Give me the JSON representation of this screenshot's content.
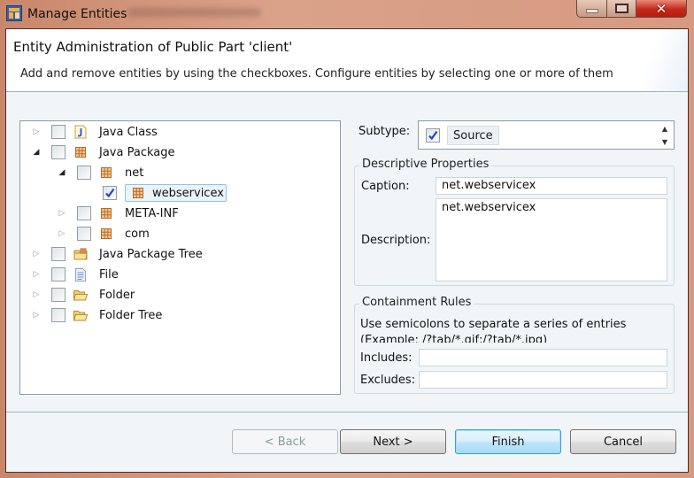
{
  "window": {
    "title": "Manage Entities",
    "controls": {
      "minimize": "minimize",
      "maximize": "maximize",
      "close": "close"
    }
  },
  "header": {
    "title": "Entity Administration of Public Part 'client'",
    "description": "Add and remove entities by using the checkboxes. Configure entities by selecting one or more of them"
  },
  "tree": {
    "items": [
      {
        "label": "Java Class",
        "icon": "java-class-icon",
        "expanded": false,
        "checked": false,
        "level": 0,
        "selected": false
      },
      {
        "label": "Java Package",
        "icon": "java-package-icon",
        "expanded": true,
        "checked": false,
        "level": 0,
        "selected": false
      },
      {
        "label": "net",
        "icon": "java-package-icon",
        "expanded": true,
        "checked": false,
        "level": 1,
        "selected": false
      },
      {
        "label": "webservicex",
        "icon": "java-package-icon",
        "expanded": null,
        "checked": true,
        "level": 2,
        "selected": true
      },
      {
        "label": "META-INF",
        "icon": "java-package-icon",
        "expanded": false,
        "checked": false,
        "level": 1,
        "selected": false
      },
      {
        "label": "com",
        "icon": "java-package-icon",
        "expanded": false,
        "checked": false,
        "level": 1,
        "selected": false
      },
      {
        "label": "Java Package Tree",
        "icon": "package-folder-icon",
        "expanded": false,
        "checked": false,
        "level": 0,
        "selected": false
      },
      {
        "label": "File",
        "icon": "file-icon",
        "expanded": false,
        "checked": false,
        "level": 0,
        "selected": false
      },
      {
        "label": "Folder",
        "icon": "folder-icon",
        "expanded": false,
        "checked": false,
        "level": 0,
        "selected": false
      },
      {
        "label": "Folder Tree",
        "icon": "folder-icon",
        "expanded": false,
        "checked": false,
        "level": 0,
        "selected": false
      }
    ]
  },
  "subtype": {
    "label": "Subtype:",
    "value": "Source",
    "checked": true
  },
  "descriptive": {
    "title": "Descriptive Properties",
    "caption_label": "Caption:",
    "caption_value": "net.webservicex",
    "description_label": "Description:",
    "description_value": "net.webservicex"
  },
  "containment": {
    "title": "Containment Rules",
    "hint_line1": "Use semicolons to separate a series of entries",
    "hint_line2": "(Example: /?tab/*.gif;/?tab/*.jpg)",
    "includes_label": "Includes:",
    "includes_value": "",
    "excludes_label": "Excludes:",
    "excludes_value": ""
  },
  "buttons": {
    "back": "< Back",
    "next": "Next >",
    "finish": "Finish",
    "cancel": "Cancel"
  }
}
